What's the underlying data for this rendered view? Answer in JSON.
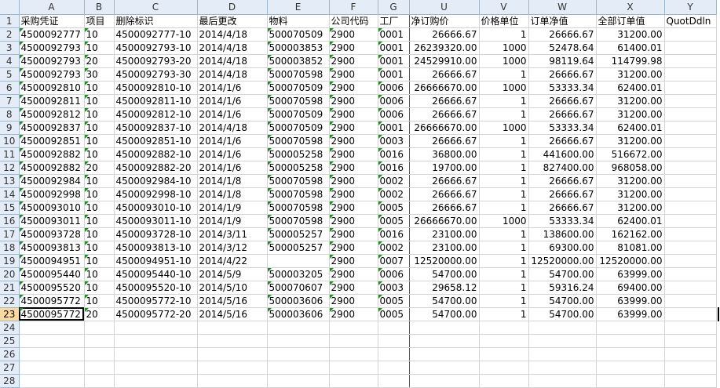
{
  "column_letters": [
    "A",
    "B",
    "C",
    "D",
    "E",
    "F",
    "G",
    "U",
    "V",
    "W",
    "X",
    "Y"
  ],
  "header_row": {
    "row_num": "1",
    "cells": [
      "采购凭证",
      "项目",
      "删除标识",
      "最后更改",
      "物料",
      "公司代码",
      "工厂",
      "净订购价",
      "价格单位",
      "订单净值",
      "全部订单值",
      "QuotDdln"
    ]
  },
  "rows": [
    {
      "row_num": "2",
      "cells": [
        "4500092777",
        "10",
        "4500092777-10",
        "2014/4/18",
        "500070509",
        "2900",
        "0001",
        "26666.67",
        "1",
        "26666.67",
        "31200.00",
        ""
      ]
    },
    {
      "row_num": "3",
      "cells": [
        "4500092793",
        "10",
        "4500092793-10",
        "2014/4/18",
        "500003853",
        "2900",
        "0001",
        "26239320.00",
        "1000",
        "52478.64",
        "61400.01",
        ""
      ]
    },
    {
      "row_num": "4",
      "cells": [
        "4500092793",
        "20",
        "4500092793-20",
        "2014/4/18",
        "500003852",
        "2900",
        "0001",
        "24529910.00",
        "1000",
        "98119.64",
        "114799.98",
        ""
      ]
    },
    {
      "row_num": "5",
      "cells": [
        "4500092793",
        "30",
        "4500092793-30",
        "2014/4/18",
        "500070598",
        "2900",
        "0001",
        "26666.67",
        "1",
        "26666.67",
        "31200.00",
        ""
      ]
    },
    {
      "row_num": "6",
      "cells": [
        "4500092810",
        "10",
        "4500092810-10",
        "2014/1/6",
        "500070509",
        "2900",
        "0006",
        "26666670.00",
        "1000",
        "53333.34",
        "62400.01",
        ""
      ]
    },
    {
      "row_num": "7",
      "cells": [
        "4500092811",
        "10",
        "4500092811-10",
        "2014/1/6",
        "500070598",
        "2900",
        "0006",
        "26666.67",
        "1",
        "26666.67",
        "31200.00",
        ""
      ]
    },
    {
      "row_num": "8",
      "cells": [
        "4500092812",
        "10",
        "4500092812-10",
        "2014/1/6",
        "500070509",
        "2900",
        "0006",
        "26666.67",
        "1",
        "26666.67",
        "31200.00",
        ""
      ]
    },
    {
      "row_num": "9",
      "cells": [
        "4500092837",
        "10",
        "4500092837-10",
        "2014/4/18",
        "500070509",
        "2900",
        "0001",
        "26666670.00",
        "1000",
        "53333.34",
        "62400.01",
        ""
      ]
    },
    {
      "row_num": "10",
      "cells": [
        "4500092851",
        "10",
        "4500092851-10",
        "2014/1/6",
        "500070598",
        "2900",
        "0003",
        "26666.67",
        "1",
        "26666.67",
        "31200.00",
        ""
      ]
    },
    {
      "row_num": "11",
      "cells": [
        "4500092882",
        "10",
        "4500092882-10",
        "2014/1/6",
        "500005258",
        "2900",
        "0016",
        "36800.00",
        "1",
        "441600.00",
        "516672.00",
        ""
      ]
    },
    {
      "row_num": "12",
      "cells": [
        "4500092882",
        "20",
        "4500092882-20",
        "2014/1/6",
        "500005258",
        "2900",
        "0016",
        "19700.00",
        "1",
        "827400.00",
        "968058.00",
        ""
      ]
    },
    {
      "row_num": "13",
      "cells": [
        "4500092984",
        "10",
        "4500092984-10",
        "2014/1/8",
        "500070598",
        "2900",
        "0002",
        "26666.67",
        "1",
        "26666.67",
        "31200.00",
        ""
      ]
    },
    {
      "row_num": "14",
      "cells": [
        "4500092998",
        "10",
        "4500092998-10",
        "2014/1/8",
        "500070598",
        "2900",
        "0002",
        "26666.67",
        "1",
        "26666.67",
        "31200.00",
        ""
      ]
    },
    {
      "row_num": "15",
      "cells": [
        "4500093010",
        "10",
        "4500093010-10",
        "2014/1/9",
        "500070598",
        "2900",
        "0005",
        "26666.67",
        "1",
        "26666.67",
        "31200.00",
        ""
      ]
    },
    {
      "row_num": "16",
      "cells": [
        "4500093011",
        "10",
        "4500093011-10",
        "2014/1/9",
        "500070598",
        "2900",
        "0005",
        "26666670.00",
        "1000",
        "53333.34",
        "62400.01",
        ""
      ]
    },
    {
      "row_num": "17",
      "cells": [
        "4500093728",
        "10",
        "4500093728-10",
        "2014/3/11",
        "500005257",
        "2900",
        "0016",
        "23100.00",
        "1",
        "138600.00",
        "162162.00",
        ""
      ]
    },
    {
      "row_num": "18",
      "cells": [
        "4500093813",
        "10",
        "4500093813-10",
        "2014/3/12",
        "500005257",
        "2900",
        "0002",
        "23100.00",
        "1",
        "69300.00",
        "81081.00",
        ""
      ]
    },
    {
      "row_num": "19",
      "cells": [
        "4500094951",
        "10",
        "4500094951-10",
        "2014/4/22",
        "",
        "2900",
        "0007",
        "12520000.00",
        "1",
        "12520000.00",
        "12520000.00",
        ""
      ]
    },
    {
      "row_num": "20",
      "cells": [
        "4500095440",
        "10",
        "4500095440-10",
        "2014/5/9",
        "500003205",
        "2900",
        "0006",
        "54700.00",
        "1",
        "54700.00",
        "63999.00",
        ""
      ]
    },
    {
      "row_num": "21",
      "cells": [
        "4500095520",
        "10",
        "4500095520-10",
        "2014/5/10",
        "500070607",
        "2900",
        "0003",
        "29658.12",
        "1",
        "59316.24",
        "69400.00",
        ""
      ]
    },
    {
      "row_num": "22",
      "cells": [
        "4500095772",
        "10",
        "4500095772-10",
        "2014/5/16",
        "500003606",
        "2900",
        "0005",
        "54700.00",
        "1",
        "54700.00",
        "63999.00",
        ""
      ]
    },
    {
      "row_num": "23",
      "cells": [
        "4500095772",
        "20",
        "4500095772-20",
        "2014/5/16",
        "500003606",
        "2900",
        "0005",
        "54700.00",
        "1",
        "54700.00",
        "63999.00",
        ""
      ]
    },
    {
      "row_num": "24",
      "cells": [
        "",
        "",
        "",
        "",
        "",
        "",
        "",
        "",
        "",
        "",
        "",
        ""
      ]
    },
    {
      "row_num": "25",
      "cells": [
        "",
        "",
        "",
        "",
        "",
        "",
        "",
        "",
        "",
        "",
        "",
        ""
      ]
    },
    {
      "row_num": "26",
      "cells": [
        "",
        "",
        "",
        "",
        "",
        "",
        "",
        "",
        "",
        "",
        "",
        ""
      ]
    },
    {
      "row_num": "27",
      "cells": [
        "",
        "",
        "",
        "",
        "",
        "",
        "",
        "",
        "",
        "",
        "",
        ""
      ]
    },
    {
      "row_num": "28",
      "cells": [
        "",
        "",
        "",
        "",
        "",
        "",
        "",
        "",
        "",
        "",
        "",
        ""
      ]
    }
  ],
  "active_row": "23",
  "colors": {
    "header_bg": "#e4ecf7",
    "active_row_header": "#f9d99f",
    "text_marker": "#1f8a1f",
    "grid_line": "#d4d4d4"
  }
}
